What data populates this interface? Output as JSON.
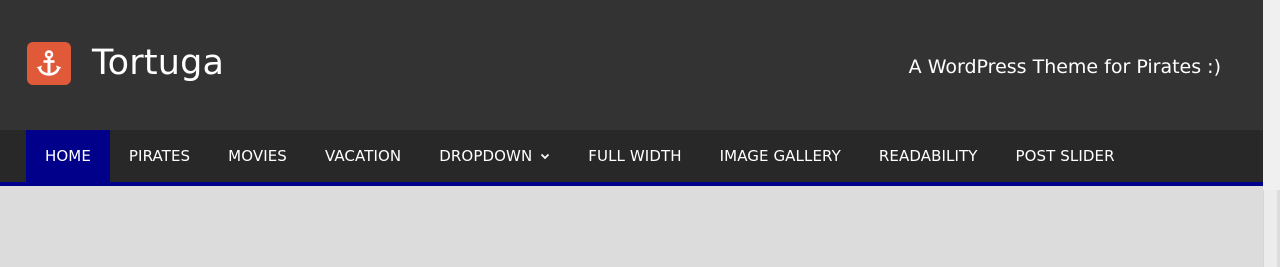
{
  "header": {
    "site_title": "Tortuga",
    "tagline": "A WordPress Theme for Pirates :)",
    "logo_icon": "anchor-icon",
    "logo_color": "#e05a3a"
  },
  "nav": {
    "accent_color": "#00008b",
    "items": [
      {
        "label": "HOME",
        "active": true
      },
      {
        "label": "PIRATES"
      },
      {
        "label": "MOVIES"
      },
      {
        "label": "VACATION"
      },
      {
        "label": "DROPDOWN",
        "has_dropdown": true
      },
      {
        "label": "FULL WIDTH"
      },
      {
        "label": "IMAGE GALLERY"
      },
      {
        "label": "READABILITY"
      },
      {
        "label": "POST SLIDER"
      }
    ]
  }
}
